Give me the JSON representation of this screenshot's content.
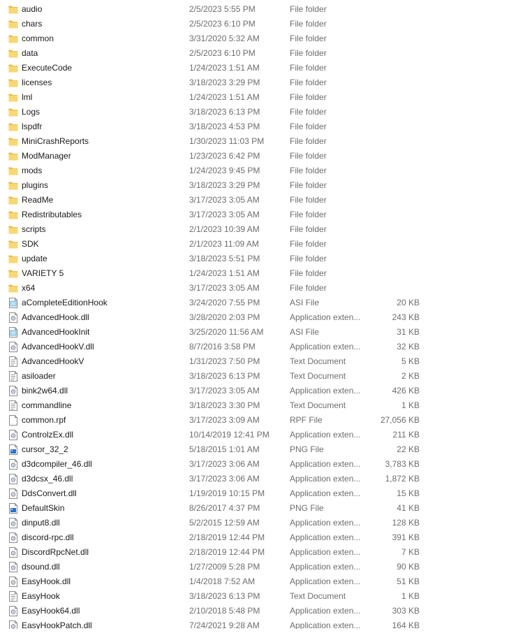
{
  "colors": {
    "folder_fill": "#f8d775",
    "folder_tab": "#e8b84a",
    "text_primary": "#1a1a1a",
    "text_secondary": "#6d6d6d"
  },
  "files": [
    {
      "name": "audio",
      "date": "2/5/2023 5:55 PM",
      "type": "File folder",
      "size": "",
      "icon": "folder-icon"
    },
    {
      "name": "chars",
      "date": "2/5/2023 6:10 PM",
      "type": "File folder",
      "size": "",
      "icon": "folder-icon"
    },
    {
      "name": "common",
      "date": "3/31/2020 5:32 AM",
      "type": "File folder",
      "size": "",
      "icon": "folder-icon"
    },
    {
      "name": "data",
      "date": "2/5/2023 6:10 PM",
      "type": "File folder",
      "size": "",
      "icon": "folder-icon"
    },
    {
      "name": "ExecuteCode",
      "date": "1/24/2023 1:51 AM",
      "type": "File folder",
      "size": "",
      "icon": "folder-icon"
    },
    {
      "name": "licenses",
      "date": "3/18/2023 3:29 PM",
      "type": "File folder",
      "size": "",
      "icon": "folder-icon"
    },
    {
      "name": "lml",
      "date": "1/24/2023 1:51 AM",
      "type": "File folder",
      "size": "",
      "icon": "folder-icon"
    },
    {
      "name": "Logs",
      "date": "3/18/2023 6:13 PM",
      "type": "File folder",
      "size": "",
      "icon": "folder-icon"
    },
    {
      "name": "lspdfr",
      "date": "3/18/2023 4:53 PM",
      "type": "File folder",
      "size": "",
      "icon": "folder-icon"
    },
    {
      "name": "MiniCrashReports",
      "date": "1/30/2023 11:03 PM",
      "type": "File folder",
      "size": "",
      "icon": "folder-icon"
    },
    {
      "name": "ModManager",
      "date": "1/23/2023 6:42 PM",
      "type": "File folder",
      "size": "",
      "icon": "folder-icon"
    },
    {
      "name": "mods",
      "date": "1/24/2023 9:45 PM",
      "type": "File folder",
      "size": "",
      "icon": "folder-icon"
    },
    {
      "name": "plugins",
      "date": "3/18/2023 3:29 PM",
      "type": "File folder",
      "size": "",
      "icon": "folder-icon"
    },
    {
      "name": "ReadMe",
      "date": "3/17/2023 3:05 AM",
      "type": "File folder",
      "size": "",
      "icon": "folder-icon"
    },
    {
      "name": "Redistributables",
      "date": "3/17/2023 3:05 AM",
      "type": "File folder",
      "size": "",
      "icon": "folder-icon"
    },
    {
      "name": "scripts",
      "date": "2/1/2023 10:39 AM",
      "type": "File folder",
      "size": "",
      "icon": "folder-icon"
    },
    {
      "name": "SDK",
      "date": "2/1/2023 11:09 AM",
      "type": "File folder",
      "size": "",
      "icon": "folder-icon"
    },
    {
      "name": "update",
      "date": "3/18/2023 5:51 PM",
      "type": "File folder",
      "size": "",
      "icon": "folder-icon"
    },
    {
      "name": "VARIETY 5",
      "date": "1/24/2023 1:51 AM",
      "type": "File folder",
      "size": "",
      "icon": "folder-icon"
    },
    {
      "name": "x64",
      "date": "3/17/2023 3:05 AM",
      "type": "File folder",
      "size": "",
      "icon": "folder-icon"
    },
    {
      "name": "aCompleteEditionHook",
      "date": "3/24/2020 7:55 PM",
      "type": "ASI File",
      "size": "20 KB",
      "icon": "asi-file-icon"
    },
    {
      "name": "AdvancedHook.dll",
      "date": "3/28/2020 2:03 PM",
      "type": "Application exten...",
      "size": "243 KB",
      "icon": "dll-file-icon"
    },
    {
      "name": "AdvancedHookInit",
      "date": "3/25/2020 11:56 AM",
      "type": "ASI File",
      "size": "31 KB",
      "icon": "asi-file-icon"
    },
    {
      "name": "AdvancedHookV.dll",
      "date": "8/7/2016 3:58 PM",
      "type": "Application exten...",
      "size": "32 KB",
      "icon": "dll-file-icon"
    },
    {
      "name": "AdvancedHookV",
      "date": "1/31/2023 7:50 PM",
      "type": "Text Document",
      "size": "5 KB",
      "icon": "text-file-icon"
    },
    {
      "name": "asiloader",
      "date": "3/18/2023 6:13 PM",
      "type": "Text Document",
      "size": "2 KB",
      "icon": "text-file-icon"
    },
    {
      "name": "bink2w64.dll",
      "date": "3/17/2023 3:05 AM",
      "type": "Application exten...",
      "size": "426 KB",
      "icon": "dll-file-icon"
    },
    {
      "name": "commandline",
      "date": "3/18/2023 3:30 PM",
      "type": "Text Document",
      "size": "1 KB",
      "icon": "text-file-icon"
    },
    {
      "name": "common.rpf",
      "date": "3/17/2023 3:09 AM",
      "type": "RPF File",
      "size": "27,056 KB",
      "icon": "blank-file-icon"
    },
    {
      "name": "ControlzEx.dll",
      "date": "10/14/2019 12:41 PM",
      "type": "Application exten...",
      "size": "211 KB",
      "icon": "dll-file-icon"
    },
    {
      "name": "cursor_32_2",
      "date": "5/18/2015 1:01 AM",
      "type": "PNG File",
      "size": "22 KB",
      "icon": "png-file-icon"
    },
    {
      "name": "d3dcompiler_46.dll",
      "date": "3/17/2023 3:06 AM",
      "type": "Application exten...",
      "size": "3,783 KB",
      "icon": "dll-file-icon"
    },
    {
      "name": "d3dcsx_46.dll",
      "date": "3/17/2023 3:06 AM",
      "type": "Application exten...",
      "size": "1,872 KB",
      "icon": "dll-file-icon"
    },
    {
      "name": "DdsConvert.dll",
      "date": "1/19/2019 10:15 PM",
      "type": "Application exten...",
      "size": "15 KB",
      "icon": "dll-file-icon"
    },
    {
      "name": "DefaultSkin",
      "date": "8/26/2017 4:37 PM",
      "type": "PNG File",
      "size": "41 KB",
      "icon": "png-file-icon"
    },
    {
      "name": "dinput8.dll",
      "date": "5/2/2015 12:59 AM",
      "type": "Application exten...",
      "size": "128 KB",
      "icon": "dll-file-icon"
    },
    {
      "name": "discord-rpc.dll",
      "date": "2/18/2019 12:44 PM",
      "type": "Application exten...",
      "size": "391 KB",
      "icon": "dll-file-icon"
    },
    {
      "name": "DiscordRpcNet.dll",
      "date": "2/18/2019 12:44 PM",
      "type": "Application exten...",
      "size": "7 KB",
      "icon": "dll-file-icon"
    },
    {
      "name": "dsound.dll",
      "date": "1/27/2009 5:28 PM",
      "type": "Application exten...",
      "size": "90 KB",
      "icon": "dll-file-icon"
    },
    {
      "name": "EasyHook.dll",
      "date": "1/4/2018 7:52 AM",
      "type": "Application exten...",
      "size": "51 KB",
      "icon": "dll-file-icon"
    },
    {
      "name": "EasyHook",
      "date": "3/18/2023 6:13 PM",
      "type": "Text Document",
      "size": "1 KB",
      "icon": "text-file-icon"
    },
    {
      "name": "EasyHook64.dll",
      "date": "2/10/2018 5:48 PM",
      "type": "Application exten...",
      "size": "303 KB",
      "icon": "dll-file-icon"
    },
    {
      "name": "EasyHookPatch.dll",
      "date": "7/24/2021 9:28 AM",
      "type": "Application exten...",
      "size": "164 KB",
      "icon": "dll-file-icon"
    }
  ]
}
